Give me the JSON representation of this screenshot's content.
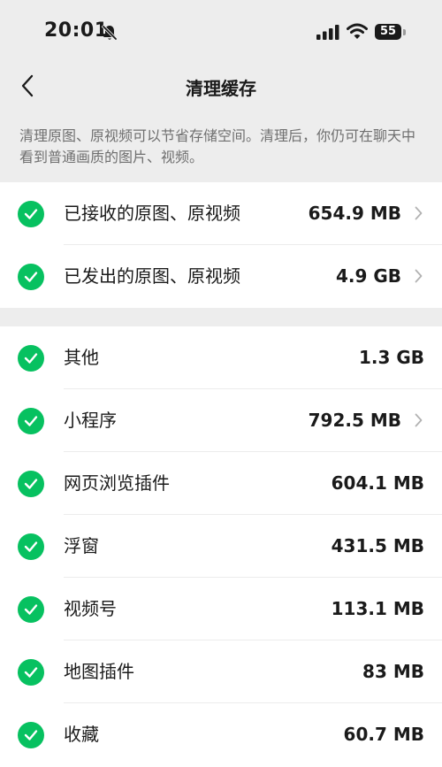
{
  "status_bar": {
    "time": "20:01",
    "battery": "55"
  },
  "nav": {
    "title": "清理缓存"
  },
  "description": "清理原图、原视频可以节省存储空间。清理后，你仍可在聊天中看到普通画质的图片、视频。",
  "group1": [
    {
      "label": "已接收的原图、原视频",
      "size": "654.9 MB",
      "checked": true,
      "has_arrow": true
    },
    {
      "label": "已发出的原图、原视频",
      "size": "4.9 GB",
      "checked": true,
      "has_arrow": true
    }
  ],
  "group2": [
    {
      "label": "其他",
      "size": "1.3 GB",
      "checked": true,
      "has_arrow": false
    },
    {
      "label": "小程序",
      "size": "792.5 MB",
      "checked": true,
      "has_arrow": true
    },
    {
      "label": "网页浏览插件",
      "size": "604.1 MB",
      "checked": true,
      "has_arrow": false
    },
    {
      "label": "浮窗",
      "size": "431.5 MB",
      "checked": true,
      "has_arrow": false
    },
    {
      "label": "视频号",
      "size": "113.1 MB",
      "checked": true,
      "has_arrow": false
    },
    {
      "label": "地图插件",
      "size": "83 MB",
      "checked": true,
      "has_arrow": false
    },
    {
      "label": "收藏",
      "size": "60.7 MB",
      "checked": true,
      "has_arrow": false
    }
  ],
  "colors": {
    "accent": "#07c160",
    "background": "#ededed",
    "card": "#ffffff",
    "muted_text": "#6f6f6f"
  },
  "icons": [
    "bell-slash-icon",
    "signal-icon",
    "wifi-icon",
    "battery-icon",
    "back-chevron-icon",
    "check-circle-icon",
    "chevron-right-icon"
  ]
}
